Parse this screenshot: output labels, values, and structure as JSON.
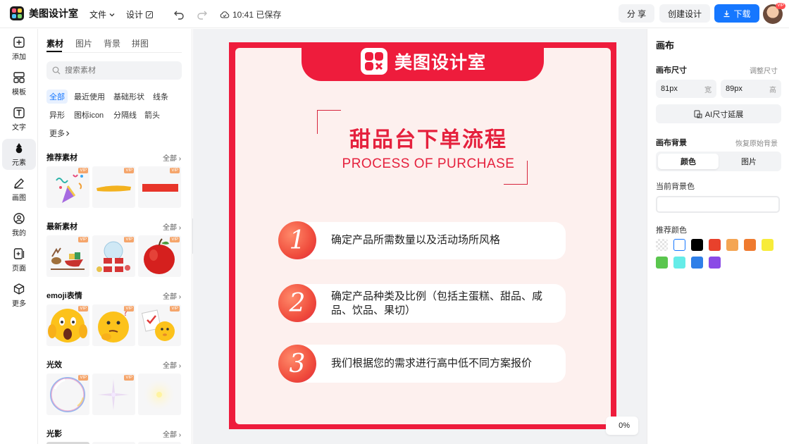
{
  "app": {
    "name": "美图设计室"
  },
  "topbar": {
    "menu_file": "文件",
    "menu_design": "设计",
    "saved_status": "10:41 已保存",
    "share_label": "分 享",
    "create_label": "创建设计",
    "download_label": "下载",
    "avatar_badge": "VIP"
  },
  "rail": {
    "items": [
      {
        "label": "添加",
        "icon": "plus-square-icon"
      },
      {
        "label": "模板",
        "icon": "template-grid-icon"
      },
      {
        "label": "文字",
        "icon": "text-icon"
      },
      {
        "label": "元素",
        "icon": "shapes-icon"
      },
      {
        "label": "画图",
        "icon": "pencil-icon"
      },
      {
        "label": "我的",
        "icon": "user-icon"
      },
      {
        "label": "页面",
        "icon": "page-add-icon"
      },
      {
        "label": "更多",
        "icon": "cube-icon"
      }
    ],
    "active_index": 3
  },
  "panel": {
    "tabs": [
      "素材",
      "图片",
      "背景",
      "拼图"
    ],
    "search_placeholder": "搜索素材",
    "chips": [
      "全部",
      "最近使用",
      "基础形状",
      "线条",
      "异形",
      "图标icon",
      "分隔线",
      "箭头",
      "更多"
    ],
    "vip_label": "VIP",
    "all_label": "全部",
    "sections": [
      {
        "title": "推荐素材"
      },
      {
        "title": "最新素材"
      },
      {
        "title": "emoji表情"
      },
      {
        "title": "光效"
      },
      {
        "title": "光影"
      }
    ]
  },
  "poster": {
    "brand": "美图设计室",
    "title": "甜品台下单流程",
    "subtitle": "PROCESS OF PURCHASE",
    "steps": [
      {
        "num": "1",
        "text": "确定产品所需数量以及活动场所风格"
      },
      {
        "num": "2",
        "text": "确定产品种类及比例（包括主蛋糕、甜品、咸品、饮品、果切）"
      },
      {
        "num": "3",
        "text": "我们根据您的需求进行高中低不同方案报价"
      }
    ],
    "colors": {
      "frame": "#ee1c3c",
      "bg": "#fdf0ee",
      "title": "#e5213d"
    }
  },
  "zoom": {
    "value": "0%"
  },
  "props": {
    "title": "画布",
    "size_label": "画布尺寸",
    "adjust_size": "调整尺寸",
    "width_value": "81px",
    "width_unit": "宽",
    "height_value": "89px",
    "height_unit": "高",
    "ai_extend": "AI尺寸延展",
    "bg_label": "画布背景",
    "restore_bg": "恢复原始背景",
    "bg_tab_color": "颜色",
    "bg_tab_image": "图片",
    "current_bg_label": "当前背景色",
    "recommended_label": "推荐颜色",
    "swatches": [
      "transparent",
      "#ffffff",
      "#000000",
      "#e8412c",
      "#f4a553",
      "#ef7a2f",
      "#f7ec3a",
      "#5ac64e",
      "#65ece8",
      "#2f7fe8",
      "#8a4ae6"
    ]
  }
}
